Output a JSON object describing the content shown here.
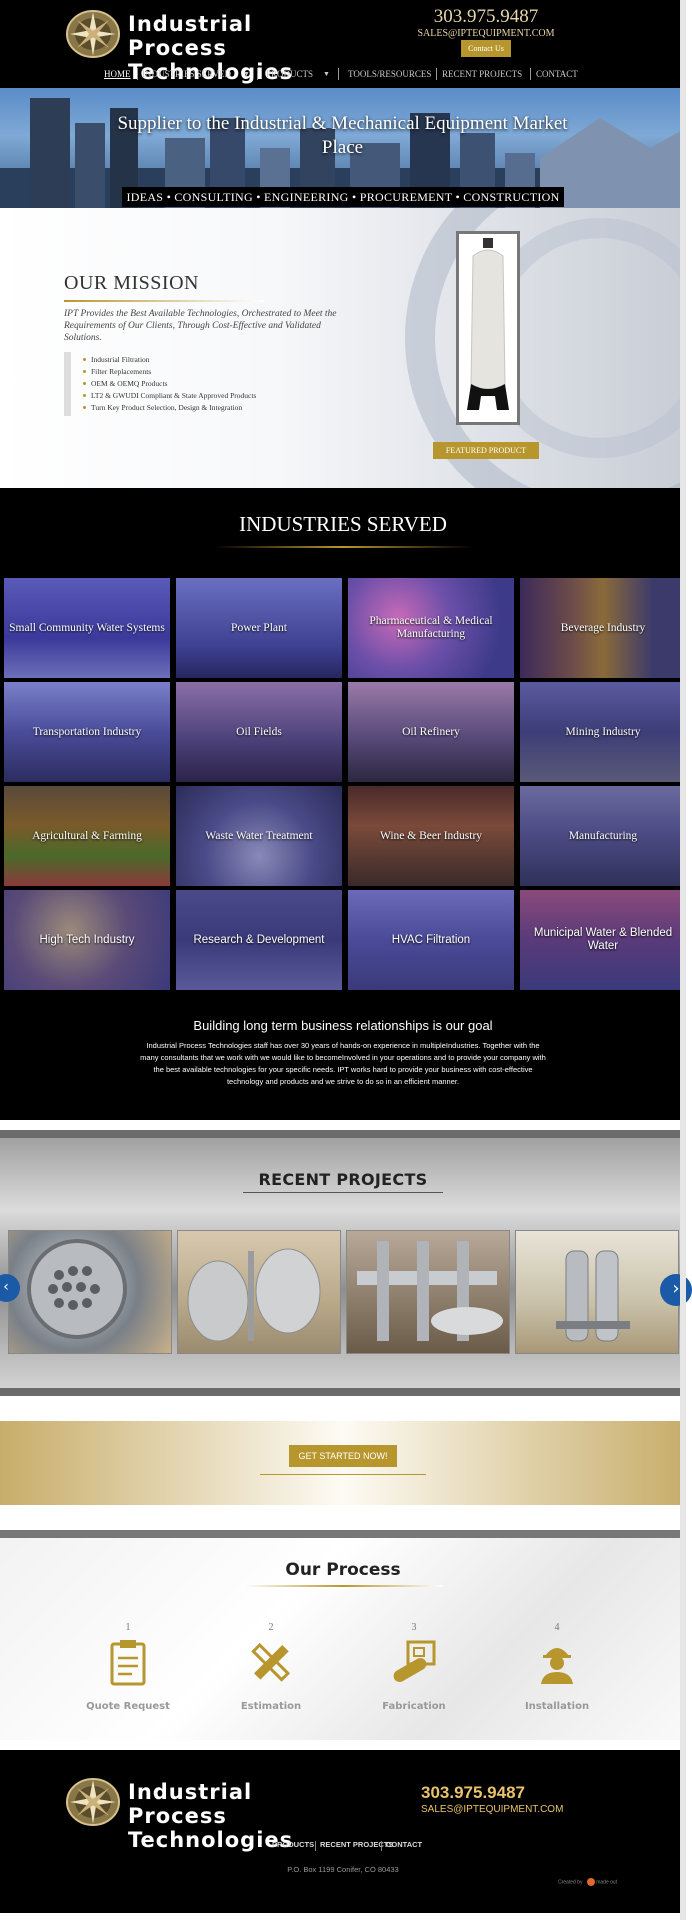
{
  "header": {
    "company_line1": "Industrial Process",
    "company_line2": "Technologies",
    "phone": "303.975.9487",
    "email": "SALES@IPTEQUIPMENT.COM",
    "contact_button": "Contact Us",
    "nav": [
      "HOME",
      "INDUSTRIES SERVED",
      "PRODUCTS",
      "TOOLS/RESOURCES",
      "RECENT PROJECTS",
      "CONTACT"
    ]
  },
  "hero": {
    "title": "Supplier to the Industrial & Mechanical Equipment Market Place",
    "tagline": "IDEAS • CONSULTING • ENGINEERING • PROCUREMENT • CONSTRUCTION"
  },
  "mission": {
    "title": "OUR MISSION",
    "text": "IPT Provides the Best Available Technologies, Orchestrated to Meet the Requirements of Our Clients, Through Cost-Effective and Validated Solutions.",
    "items": [
      "Industrial Filtration",
      "Filter Replacements",
      "OEM & OEMQ Products",
      "LT2 & GWUDI Compliant & State Approved Products",
      "Turn Key Product Selection, Design & Integration"
    ],
    "featured_button": "FEATURED PRODUCT"
  },
  "industries": {
    "title": "INDUSTRIES SERVED",
    "tiles": [
      "Small Community Water Systems",
      "Power Plant",
      "Pharmaceutical & Medical Manufacturing",
      "Beverage Industry",
      "Transportation Industry",
      "Oil Fields",
      "Oil Refinery",
      "Mining Industry",
      "Agricultural & Farming",
      "Waste Water Treatment",
      "Wine & Beer Industry",
      "Manufacturing",
      "High Tech Industry",
      "Research & Development",
      "HVAC Filtration",
      "Municipal Water & Blended Water"
    ]
  },
  "relationship": {
    "title": "Building long term business relationships is our goal",
    "text": "Industrial Process Technologies staff has over 30 years of hands-on experience in multipleIndustries. Together with the many consultants that we work with we would like to becomeInvolved in your operations and to provide your company with the best available technologies for your specific needs. IPT works hard to provide your business with cost-effective technology and products and we strive to do so in an efficient manner."
  },
  "projects": {
    "title": "RECENT PROJECTS"
  },
  "get_started": {
    "button": "GET STARTED NOW!"
  },
  "process": {
    "title": "Our Process",
    "steps": [
      {
        "num": "1",
        "label": "Quote Request",
        "icon": "clipboard-icon"
      },
      {
        "num": "2",
        "label": "Estimation",
        "icon": "ruler-pencil-icon"
      },
      {
        "num": "3",
        "label": "Fabrication",
        "icon": "blueprint-icon"
      },
      {
        "num": "4",
        "label": "Installation",
        "icon": "worker-icon"
      }
    ]
  },
  "footer": {
    "company_line1": "Industrial Process",
    "company_line2": "Technologies",
    "phone": "303.975.9487",
    "email": "SALES@IPTEQUIPMENT.COM",
    "nav": [
      "PRODUCTS",
      "RECENT PROJECTS",
      "CONTACT"
    ],
    "address": "P.O. Box 1199 Conifer, CO 80433",
    "credit": "Created by",
    "credit_brand": "made out"
  },
  "colors": {
    "gold": "#b8962e",
    "black": "#000000",
    "tile_tint": "#3b3a9c",
    "arrow_blue": "#1b5aa6"
  }
}
